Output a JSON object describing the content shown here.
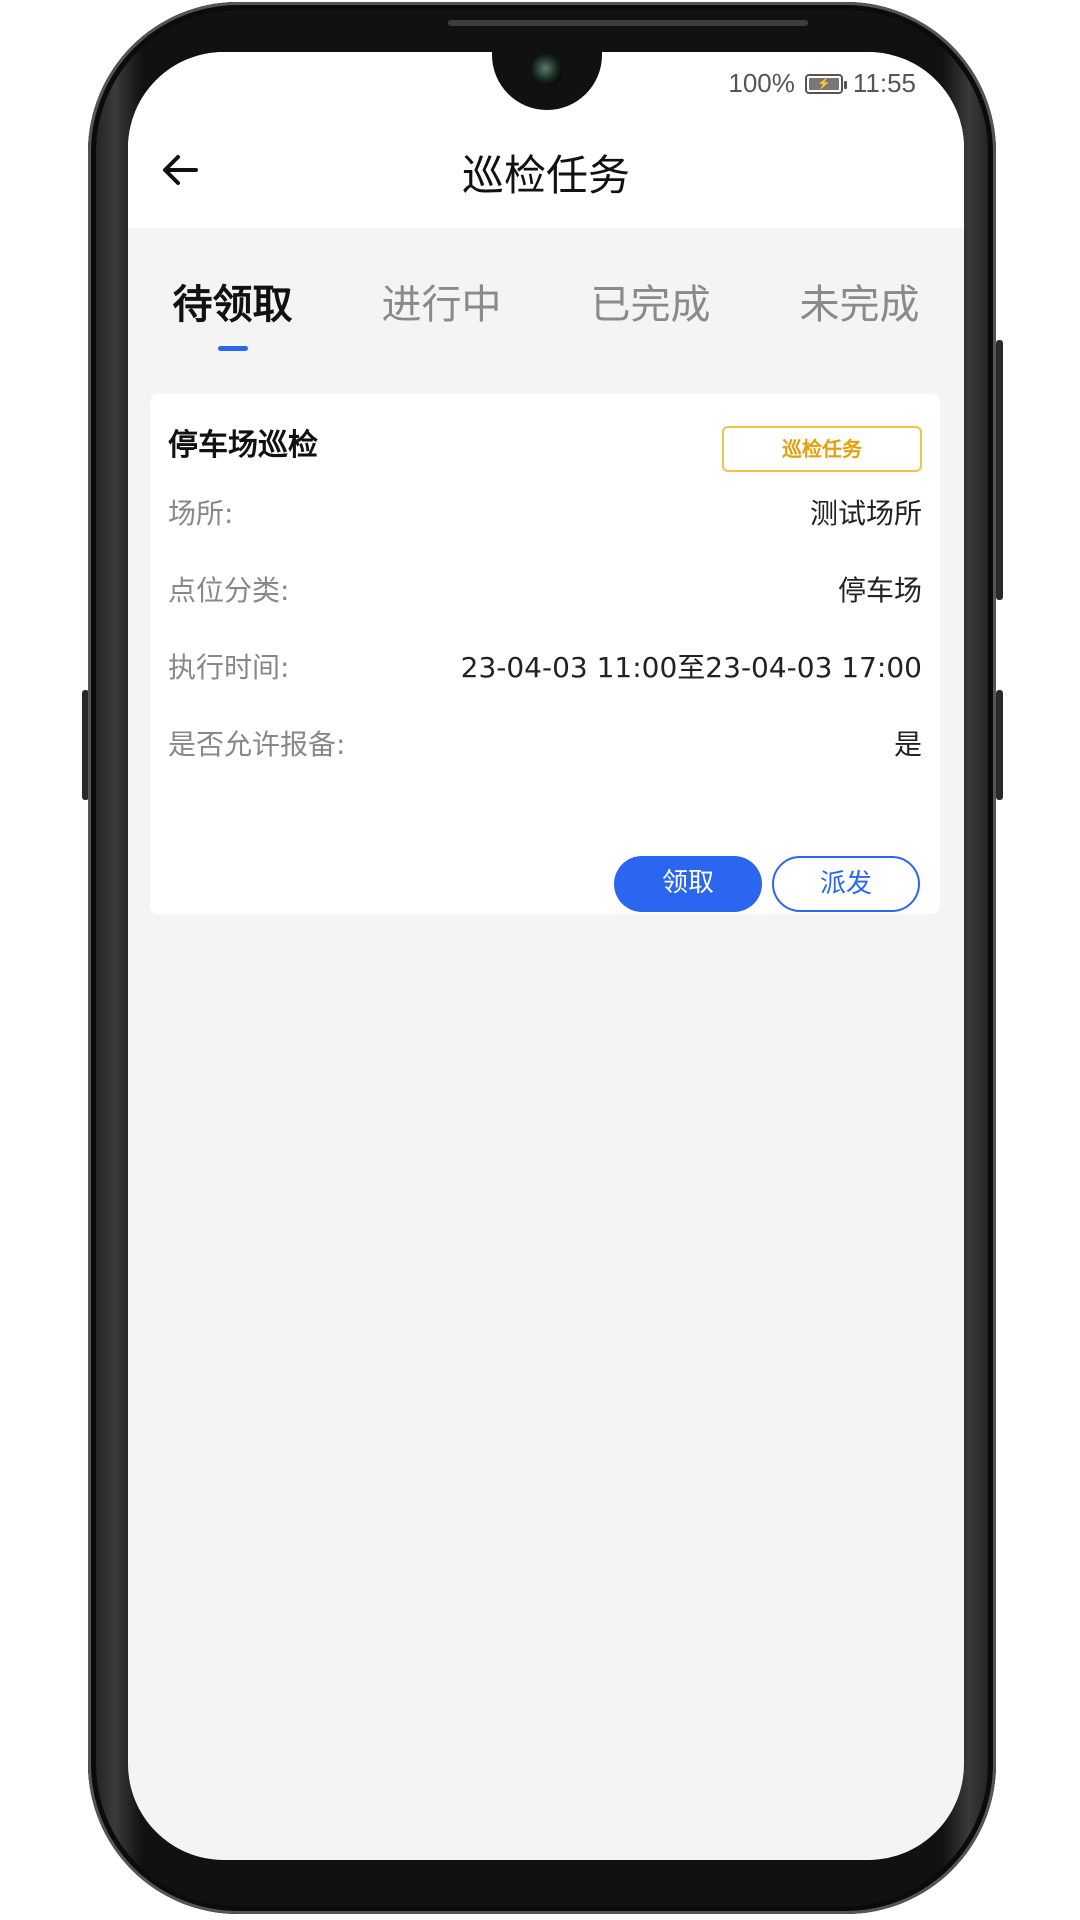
{
  "status_bar": {
    "battery": "100%",
    "time": "11:55"
  },
  "header": {
    "title": "巡检任务",
    "back_icon": "arrow-left-icon"
  },
  "tabs": [
    {
      "label": "待领取",
      "active": true
    },
    {
      "label": "进行中",
      "active": false
    },
    {
      "label": "已完成",
      "active": false
    },
    {
      "label": "未完成",
      "active": false
    }
  ],
  "task_card": {
    "title": "停车场巡检",
    "tag": "巡检任务",
    "rows": [
      {
        "label": "场所:",
        "value": "测试场所"
      },
      {
        "label": "点位分类:",
        "value": "停车场"
      },
      {
        "label": "执行时间:",
        "value": "23-04-03 11:00至23-04-03 17:00"
      },
      {
        "label": "是否允许报备:",
        "value": "是"
      }
    ],
    "claim_label": "领取",
    "dispatch_label": "派发"
  },
  "colors": {
    "accent": "#2b66f0",
    "tag": "#e3a00c",
    "background": "#f4f4f4"
  }
}
